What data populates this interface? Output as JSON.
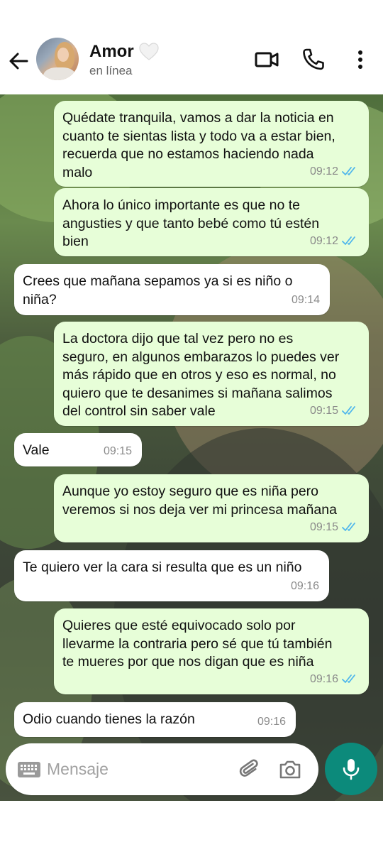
{
  "header": {
    "contact_name": "Amor",
    "contact_emoji": "white-heart",
    "status": "en línea",
    "icons": [
      "back-arrow-icon",
      "video-call-icon",
      "phone-icon",
      "more-vert-icon"
    ]
  },
  "messages": [
    {
      "direction": "outgoing",
      "text": "Quédate tranquila, vamos a dar la noticia  en\ncuanto te sientas lista y todo va a estar bien,\nrecuerda que no estamos haciendo nada\nmalo",
      "time": "09:12",
      "read": true
    },
    {
      "direction": "outgoing",
      "text": "Ahora lo único importante es que no te\nangusties y que tanto bebé como tú estén\nbien",
      "time": "09:12",
      "read": true
    },
    {
      "direction": "incoming",
      "text": "Crees que mañana sepamos ya si es niño o\nniña?",
      "time": "09:14"
    },
    {
      "direction": "outgoing",
      "text": "La doctora dijo que tal vez pero no es\nseguro, en algunos embarazos lo puedes ver\nmás rápido que en otros y eso es normal, no\nquiero que te desanimes si mañana salimos\ndel control sin saber vale",
      "time": "09:15",
      "read": true
    },
    {
      "direction": "incoming",
      "text": "Vale",
      "time": "09:15"
    },
    {
      "direction": "outgoing",
      "text": "Aunque yo estoy seguro que es niña pero\nveremos si nos deja ver mi princesa mañana",
      "time": "09:15",
      "read": true
    },
    {
      "direction": "incoming",
      "text": "Te quiero ver la cara si resulta que es un niño",
      "time": "09:16"
    },
    {
      "direction": "outgoing",
      "text": "Quieres que esté equivocado solo por\nllevarme la contraria pero sé que tú también\nte mueres por que nos digan que es niña",
      "time": "09:16",
      "read": true
    },
    {
      "direction": "incoming",
      "text": "Odio cuando tienes la razón",
      "time": "09:16"
    }
  ],
  "composer": {
    "placeholder": "Mensaje",
    "icons": [
      "keyboard-icon",
      "attach-icon",
      "camera-icon",
      "mic-icon"
    ]
  },
  "colors": {
    "outgoing_bubble": "#e7fed8",
    "incoming_bubble": "#ffffff",
    "read_ticks": "#4fb6ec",
    "mic_button": "#0c8a7b"
  }
}
